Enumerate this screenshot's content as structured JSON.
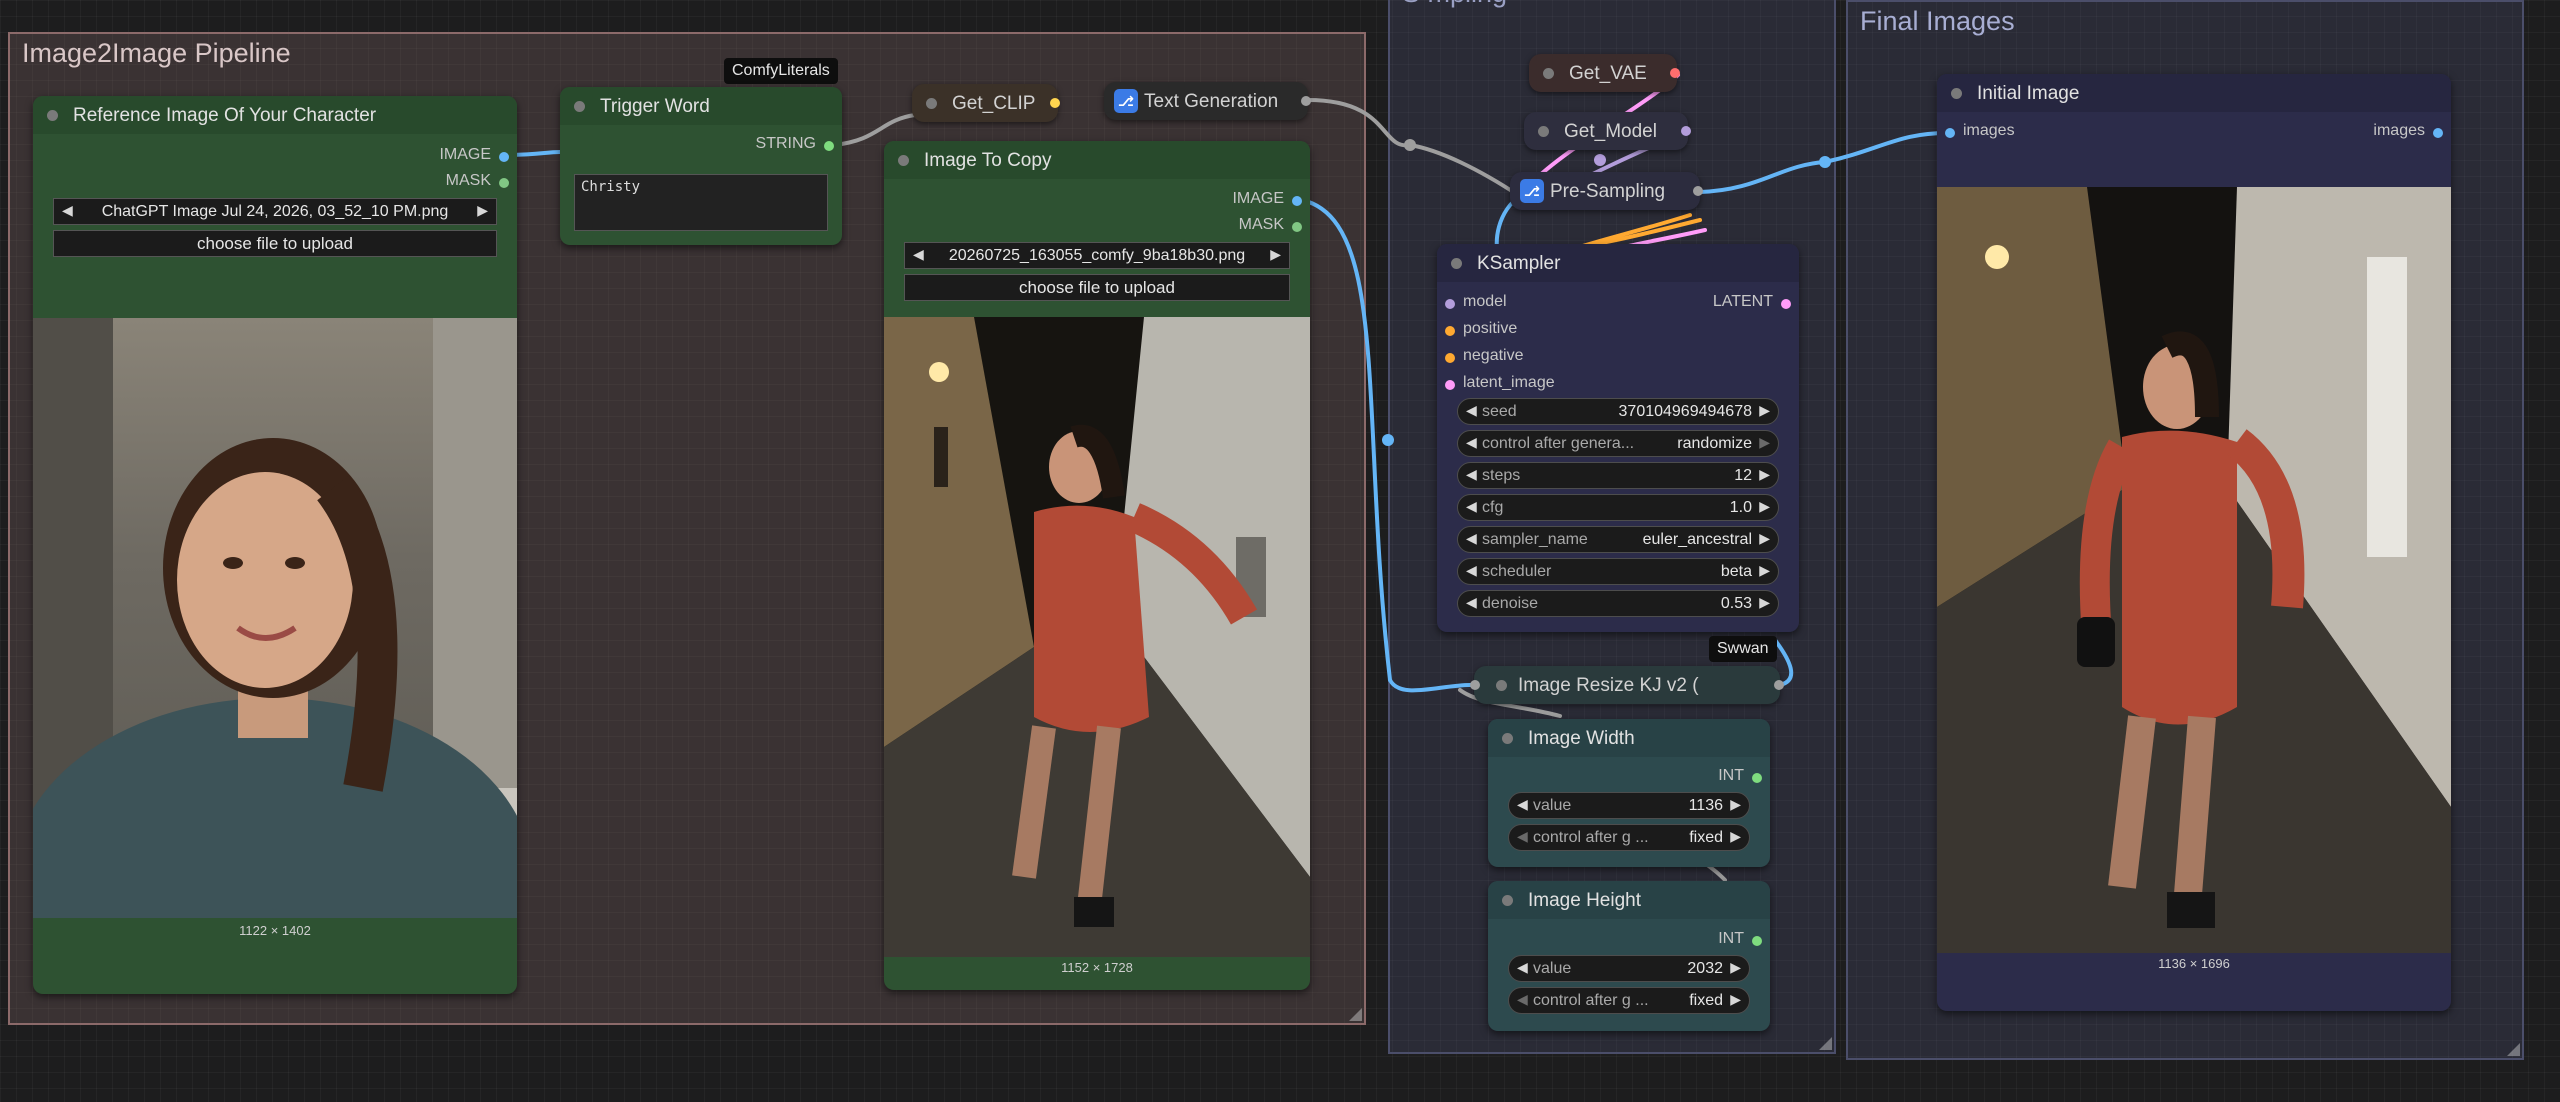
{
  "groups": {
    "pipeline": {
      "title": "Image2Image Pipeline",
      "color": "#8c6a6a"
    },
    "sampling": {
      "title": "Sampling",
      "color": "#4b4e6a"
    },
    "final": {
      "title": "Final Images",
      "color": "#4b4e6a"
    }
  },
  "ref_node": {
    "title": "Reference Image Of Your Character",
    "out_image": "IMAGE",
    "out_mask": "MASK",
    "file": "ChatGPT Image Jul 24, 2026, 03_52_10 PM.png",
    "upload": "choose file to upload",
    "dims": "1122 × 1402"
  },
  "trigger_node": {
    "badge": "ComfyLiterals",
    "title": "Trigger Word",
    "out_string": "STRING",
    "text": "Christy"
  },
  "copy_node": {
    "title": "Image To Copy",
    "out_image": "IMAGE",
    "out_mask": "MASK",
    "file": "20260725_163055_comfy_9ba18b30.png",
    "upload": "choose file to upload",
    "dims": "1152 × 1728"
  },
  "pills": {
    "get_clip": "Get_CLIP",
    "text_gen": "Text Generation",
    "get_vae": "Get_VAE",
    "get_model": "Get_Model",
    "pre_sampling": "Pre-Sampling"
  },
  "ksampler": {
    "title": "KSampler",
    "inputs": [
      "model",
      "positive",
      "negative",
      "latent_image"
    ],
    "output": "LATENT",
    "widgets": [
      {
        "label": "seed",
        "value": "370104969494678"
      },
      {
        "label": "control after genera...",
        "value": "randomize"
      },
      {
        "label": "steps",
        "value": "12"
      },
      {
        "label": "cfg",
        "value": "1.0"
      },
      {
        "label": "sampler_name",
        "value": "euler_ancestral"
      },
      {
        "label": "scheduler",
        "value": "beta"
      },
      {
        "label": "denoise",
        "value": "0.53"
      }
    ]
  },
  "swwan_badge": "Swwan",
  "resize_node": {
    "title": "Image Resize KJ v2 ("
  },
  "width_node": {
    "title": "Image Width",
    "output": "INT",
    "value_label": "value",
    "value": "1136",
    "control_label": "control after g ...",
    "control_value": "fixed"
  },
  "height_node": {
    "title": "Image Height",
    "output": "INT",
    "value_label": "value",
    "value": "2032",
    "control_label": "control after g ...",
    "control_value": "fixed"
  },
  "initial_node": {
    "title": "Initial Image",
    "in_images": "images",
    "out_images": "images",
    "dims": "1136 × 1696"
  },
  "colors": {
    "image_port": "#64b5f6",
    "mask_port": "#81c784",
    "string_port": "#7fdc7f",
    "int_port": "#7fdc7f",
    "model_port": "#b39ddb",
    "cond_port": "#ffa931",
    "latent_port": "#ff9cf9",
    "green_node": "#2e5232",
    "purple_node": "#2c2c4a",
    "teal_node": "#2d4a4e"
  },
  "icons": {
    "text_gen": "graph-icon",
    "pre_sampling": "graph-icon",
    "node_dot": "collapse-dot-icon"
  }
}
